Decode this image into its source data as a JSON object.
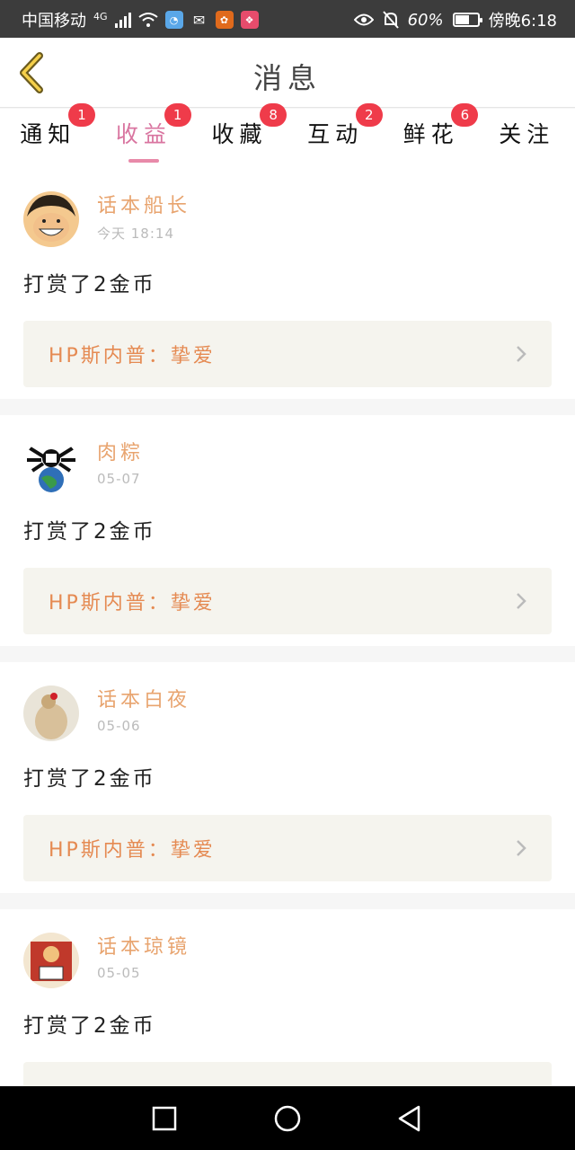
{
  "status_bar": {
    "carrier": "中国移动",
    "network": "4G",
    "battery_percent": "60%",
    "time": "傍晚6:18"
  },
  "header": {
    "title": "消息"
  },
  "tabs": [
    {
      "label": "通知",
      "badge": "1",
      "active": false
    },
    {
      "label": "收益",
      "badge": "1",
      "active": true
    },
    {
      "label": "收藏",
      "badge": "8",
      "active": false
    },
    {
      "label": "互动",
      "badge": "2",
      "active": false
    },
    {
      "label": "鲜花",
      "badge": "6",
      "active": false
    },
    {
      "label": "关注",
      "badge": "",
      "active": false
    }
  ],
  "messages": [
    {
      "user": "话本船长",
      "time": "今天 18:14",
      "text": "打赏了2金币",
      "ref": "HP斯内普：挚爱"
    },
    {
      "user": "肉粽",
      "time": "05-07",
      "text": "打赏了2金币",
      "ref": "HP斯内普：挚爱"
    },
    {
      "user": "话本白夜",
      "time": "05-06",
      "text": "打赏了2金币",
      "ref": "HP斯内普：挚爱"
    },
    {
      "user": "话本琼镜",
      "time": "05-05",
      "text": "打赏了2金币",
      "ref": ""
    }
  ],
  "colors": {
    "accent_pink": "#d975a0",
    "badge_red": "#ef3b4a",
    "username_orange": "#e8a46f",
    "ref_orange": "#e58a52"
  }
}
